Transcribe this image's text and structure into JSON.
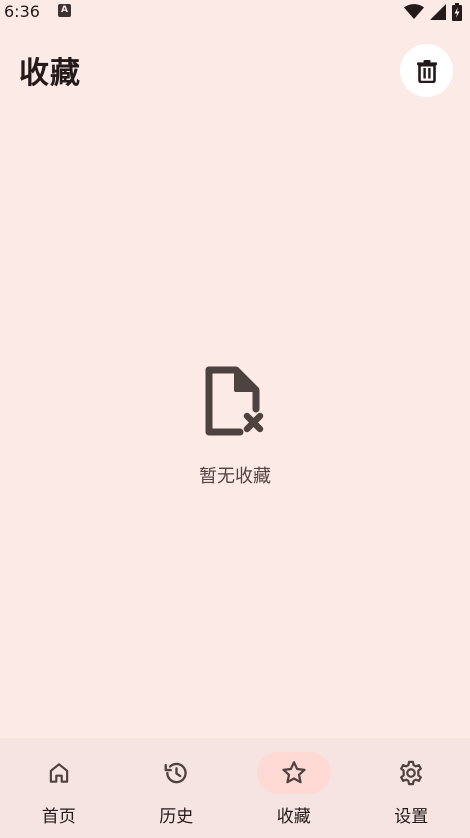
{
  "status_bar": {
    "time": "6:36",
    "app_icon_letter": "A"
  },
  "header": {
    "title": "收藏",
    "delete_icon": "trash-icon"
  },
  "empty_state": {
    "icon": "file-remove-icon",
    "message": "暂无收藏"
  },
  "bottom_nav": {
    "items": [
      {
        "label": "首页",
        "icon": "home-icon",
        "active": false
      },
      {
        "label": "历史",
        "icon": "history-icon",
        "active": false
      },
      {
        "label": "收藏",
        "icon": "star-icon",
        "active": true
      },
      {
        "label": "设置",
        "icon": "settings-icon",
        "active": false
      }
    ]
  },
  "colors": {
    "background": "#fceae7",
    "nav_background": "#f5e4e1",
    "active_indicator": "#ffdad5",
    "icon": "#4e4240",
    "text": "#231a19"
  }
}
